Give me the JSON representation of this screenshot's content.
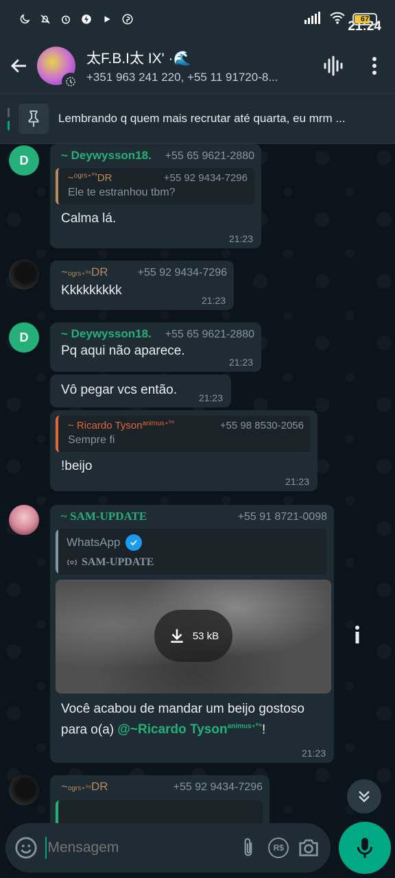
{
  "status_bar": {
    "time": "21:24",
    "battery": "67"
  },
  "header": {
    "group_name": "太F.B.I太 IX' ·🌊",
    "participants": "+351 963 241 220, +55 11 91720-8..."
  },
  "pinned": {
    "text": "Lembrando q quem mais recrutar até quarta, eu mrm ..."
  },
  "messages": [
    {
      "avatar": "D",
      "sender": "~ Deywysson18.",
      "phone": "+55 65 9621-2880",
      "quote": {
        "sender": "~ ",
        "sender_sup": "ogrs⋆⁰⁹",
        "sender_suffix": " DR",
        "phone": "+55 92 9434-7296",
        "text": "Ele te estranhou tbm?"
      },
      "text": "Calma lá.",
      "time": "21:23"
    },
    {
      "sender": "~ ",
      "sender_sup": "ogrs⋆⁰⁹",
      "sender_suffix": " DR",
      "phone": "+55 92 9434-7296",
      "text": "Kkkkkkkkk",
      "time": "21:23"
    },
    {
      "avatar": "D",
      "sender": "~ Deywysson18.",
      "phone": "+55 65 9621-2880",
      "text": "Pq aqui não aparece.",
      "time": "21:23"
    },
    {
      "text": "Vô pegar vcs então.",
      "time": "21:23"
    },
    {
      "quote": {
        "sender": "~ Ricardo Tyson",
        "sender_sup": "animus⋆⁰⁹",
        "phone": "+55 98 8530-2056",
        "text": "Sempre fi"
      },
      "text": "!beijo",
      "time": "21:23"
    },
    {
      "sender": "~ SAM-UPDATE",
      "phone": "+55 91 8721-0098",
      "preview": {
        "app": "WhatsApp",
        "channel": "SAM-UPDATE",
        "download_size": "53 kB"
      },
      "text_prefix": "Você acabou de mandar um beijo gostoso para o(a) ",
      "mention": "@~Ricardo Tyson",
      "mention_sup": "animus⋆⁰⁹",
      "text_suffix": "!",
      "time": "21:23"
    },
    {
      "sender": "~ ",
      "sender_sup": "ogrs⋆⁰⁹",
      "sender_suffix": " DR",
      "phone": "+55 92 9434-7296"
    }
  ],
  "composer": {
    "placeholder": "Mensagem",
    "currency_label": "R$"
  },
  "colors": {
    "accent": "#00a884",
    "bubble": "#202c33",
    "background": "#0b141a"
  }
}
